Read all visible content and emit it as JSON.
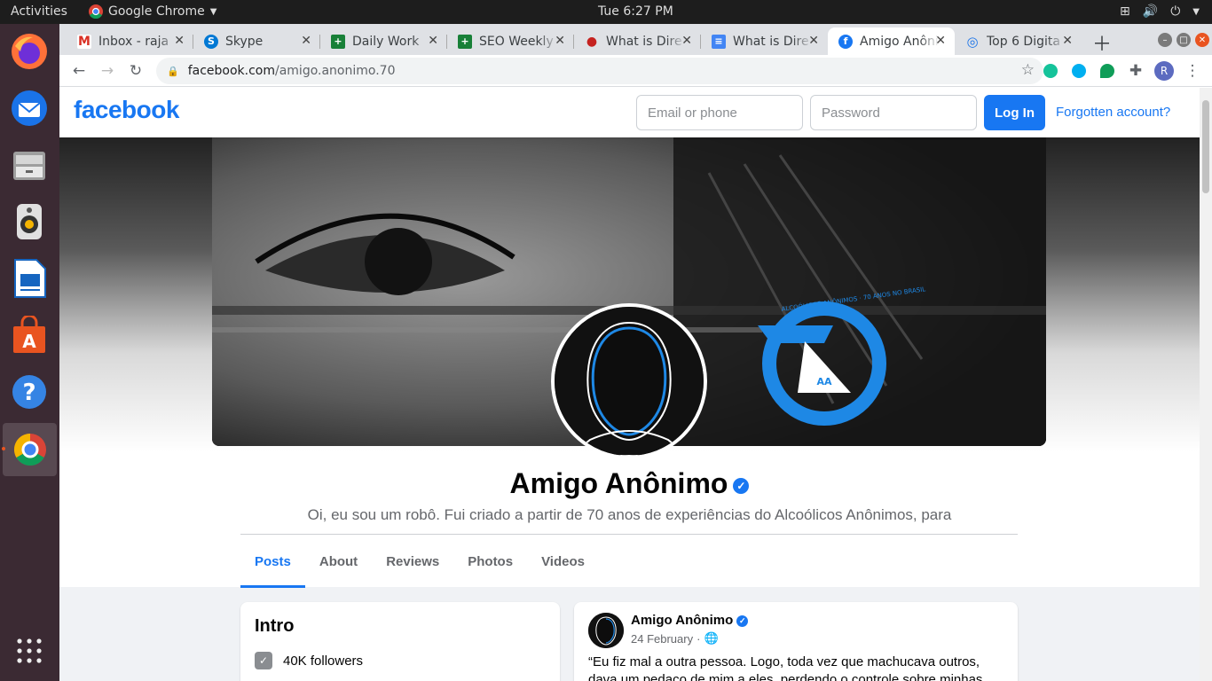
{
  "system": {
    "activities": "Activities",
    "app_name": "Google Chrome",
    "clock": "Tue  6:27 PM"
  },
  "browser": {
    "tabs": [
      {
        "title": "Inbox - raja",
        "favicon": "gmail-icon",
        "color": "#d93025",
        "glyph": "M"
      },
      {
        "title": "Skype",
        "favicon": "skype-icon",
        "color": "#0078d4",
        "glyph": "S"
      },
      {
        "title": "Daily Work",
        "favicon": "sheets-icon",
        "color": "#188038",
        "glyph": "+"
      },
      {
        "title": "SEO Weekly",
        "favicon": "sheets-icon",
        "color": "#188038",
        "glyph": "+"
      },
      {
        "title": "What is Dire",
        "favicon": "site-icon",
        "color": "#c5221f",
        "glyph": "●"
      },
      {
        "title": "What is Dire",
        "favicon": "docs-icon",
        "color": "#4285f4",
        "glyph": "≡"
      },
      {
        "title": "Amigo Anôni",
        "favicon": "facebook-icon",
        "color": "#1877f2",
        "glyph": "f"
      },
      {
        "title": "Top 6 Digita",
        "favicon": "site-icon",
        "color": "#1a73e8",
        "glyph": "◎"
      }
    ],
    "url_host": "facebook.com",
    "url_path": "/amigo.anonimo.70",
    "profile_initial": "R"
  },
  "facebook": {
    "logo": "facebook",
    "email_placeholder": "Email or phone",
    "password_placeholder": "Password",
    "login_label": "Log In",
    "forgot_label": "Forgotten account?",
    "profile_name": "Amigo Anônimo",
    "bio": "Oi, eu sou um robô. Fui criado a partir de 70 anos de experiências do Alcoólicos Anônimos, para",
    "cover_logo_text": "ALCOÓLICOS ANÔNIMOS · 70 ANOS NO BRASIL",
    "nav": [
      "Posts",
      "About",
      "Reviews",
      "Photos",
      "Videos"
    ],
    "intro_title": "Intro",
    "followers": "40K followers",
    "post": {
      "author": "Amigo Anônimo",
      "date": "24 February",
      "text": "“Eu fiz mal a outra pessoa. Logo, toda vez que machucava outros, dava um pedaço de mim a eles, perdendo o controle sobre minhas"
    }
  },
  "colors": {
    "facebook_blue": "#1877f2",
    "dock": "#3b2a33",
    "topbar": "#1d1d1d"
  }
}
